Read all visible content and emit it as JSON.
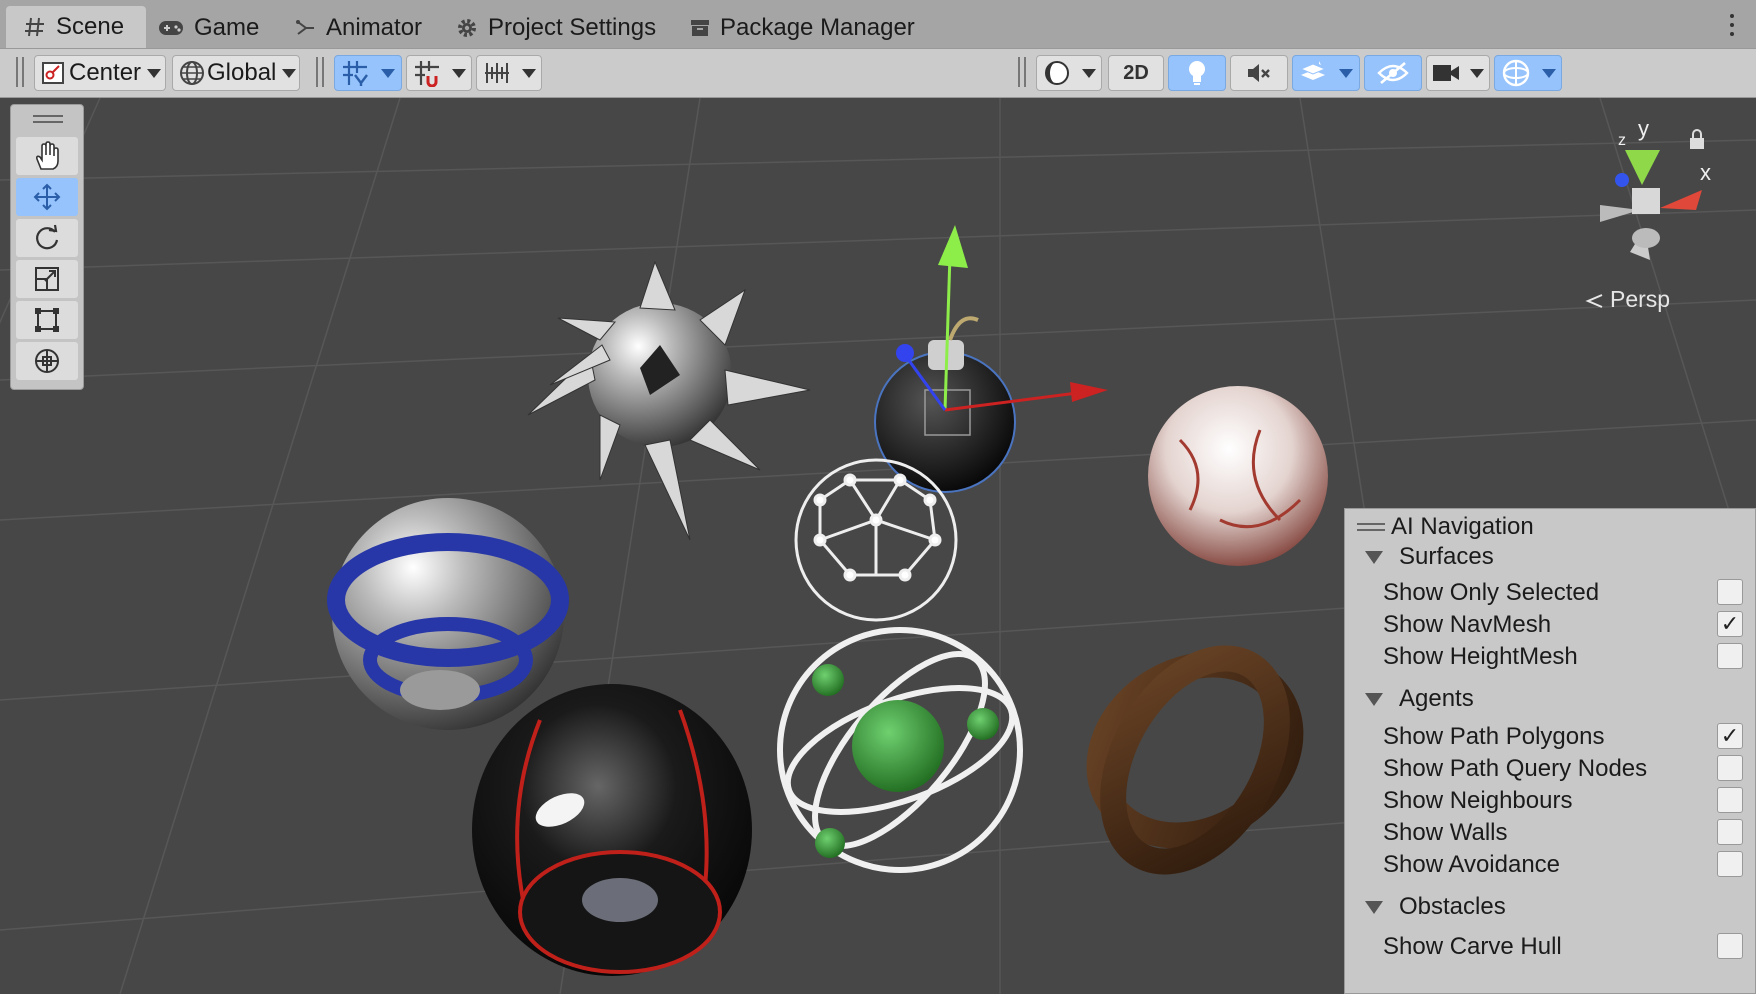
{
  "tabs": [
    {
      "label": "Scene",
      "icon": "hash-icon",
      "active": true
    },
    {
      "label": "Game",
      "icon": "gamepad-icon"
    },
    {
      "label": "Animator",
      "icon": "animator-icon"
    },
    {
      "label": "Project Settings",
      "icon": "gear-icon"
    },
    {
      "label": "Package Manager",
      "icon": "package-icon"
    }
  ],
  "toolbar": {
    "pivot_label": "Center",
    "space_label": "Global",
    "mode_2d_label": "2D"
  },
  "gizmo": {
    "axis_y": "y",
    "axis_x": "x",
    "axis_z": "z",
    "projection_label": "Persp"
  },
  "ai_navigation": {
    "title": "AI Navigation",
    "sections": [
      {
        "name": "Surfaces",
        "items": [
          {
            "label": "Show Only Selected",
            "checked": false
          },
          {
            "label": "Show NavMesh",
            "checked": true
          },
          {
            "label": "Show HeightMesh",
            "checked": false
          }
        ]
      },
      {
        "name": "Agents",
        "items": [
          {
            "label": "Show Path Polygons",
            "checked": true
          },
          {
            "label": "Show Path Query Nodes",
            "checked": false
          },
          {
            "label": "Show Neighbours",
            "checked": false
          },
          {
            "label": "Show Walls",
            "checked": false
          },
          {
            "label": "Show Avoidance",
            "checked": false
          }
        ]
      },
      {
        "name": "Obstacles",
        "items": [
          {
            "label": "Show Carve Hull",
            "checked": false
          }
        ]
      }
    ]
  },
  "colors": {
    "selected_blue": "#96c3fb",
    "scene_bg": "#474747",
    "panel_bg": "#c8c8c8"
  }
}
